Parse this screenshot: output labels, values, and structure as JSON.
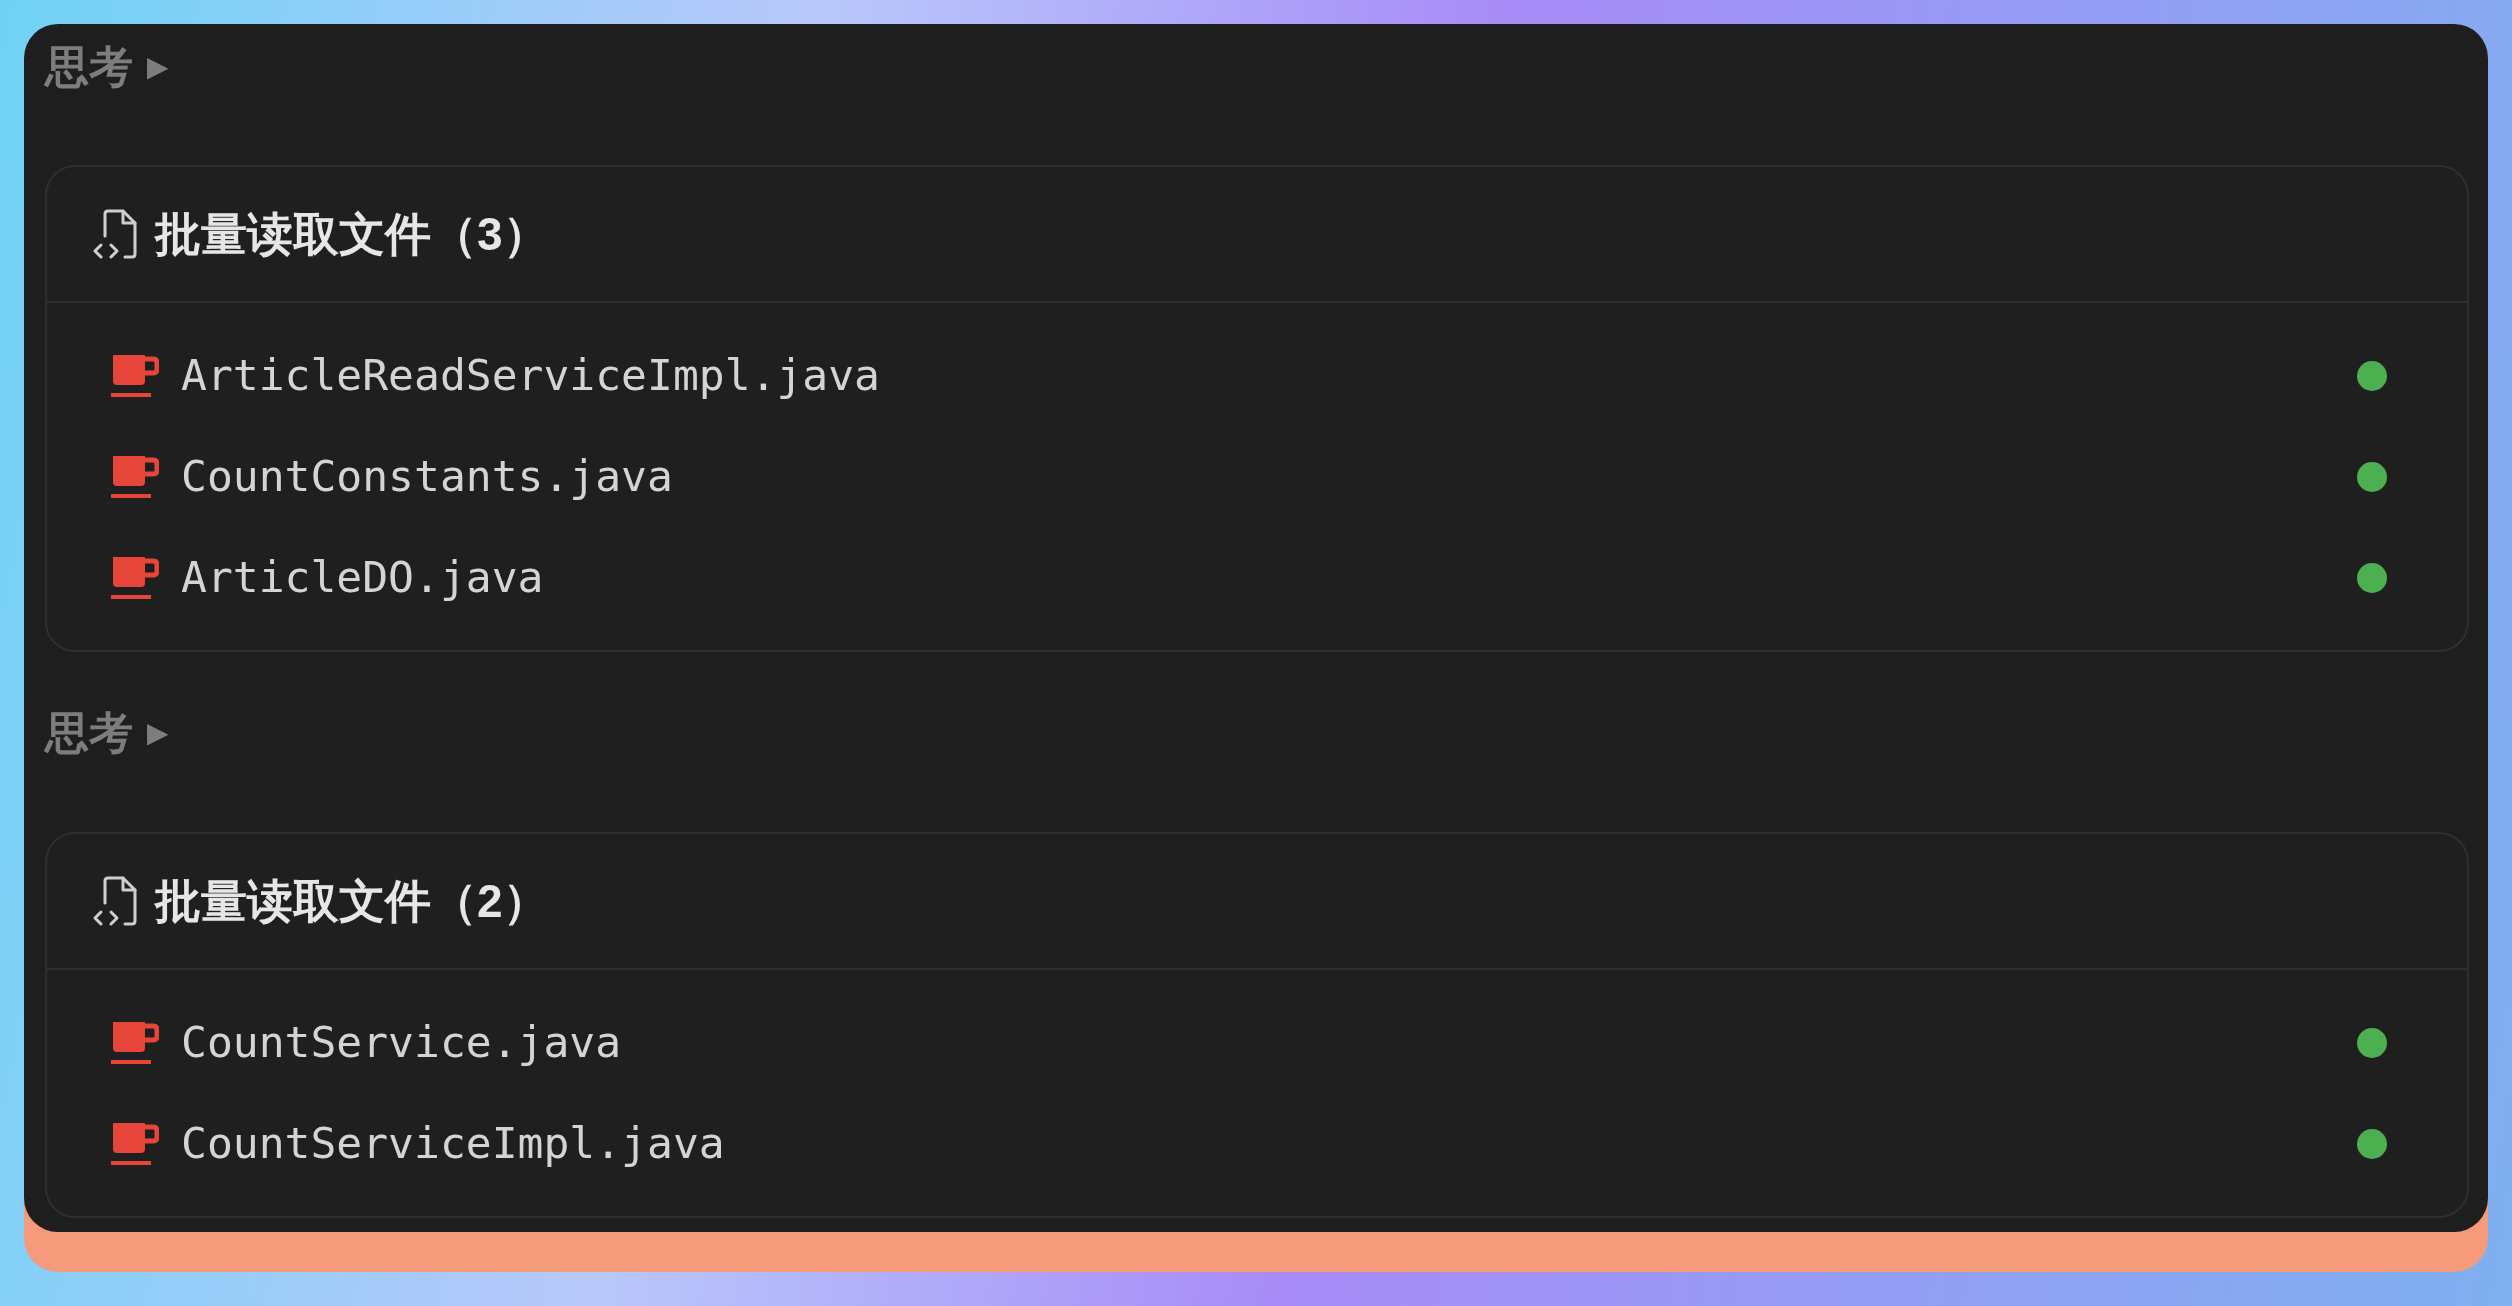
{
  "sections": [
    {
      "thinking": {
        "label": "思考",
        "toggle": "▶",
        "expanded": false
      },
      "card": {
        "title": "批量读取文件（3）",
        "files": [
          {
            "name": "ArticleReadServiceImpl.java",
            "color": "#4caf50"
          },
          {
            "name": "CountConstants.java",
            "color": "#4caf50"
          },
          {
            "name": "ArticleDO.java",
            "color": "#4caf50"
          }
        ]
      }
    },
    {
      "thinking": {
        "label": "思考",
        "toggle": "▶",
        "expanded": false
      },
      "card": {
        "title": "批量读取文件（2）",
        "files": [
          {
            "name": "CountService.java",
            "color": "#4caf50"
          },
          {
            "name": "CountServiceImpl.java",
            "color": "#4caf50"
          }
        ]
      }
    }
  ]
}
